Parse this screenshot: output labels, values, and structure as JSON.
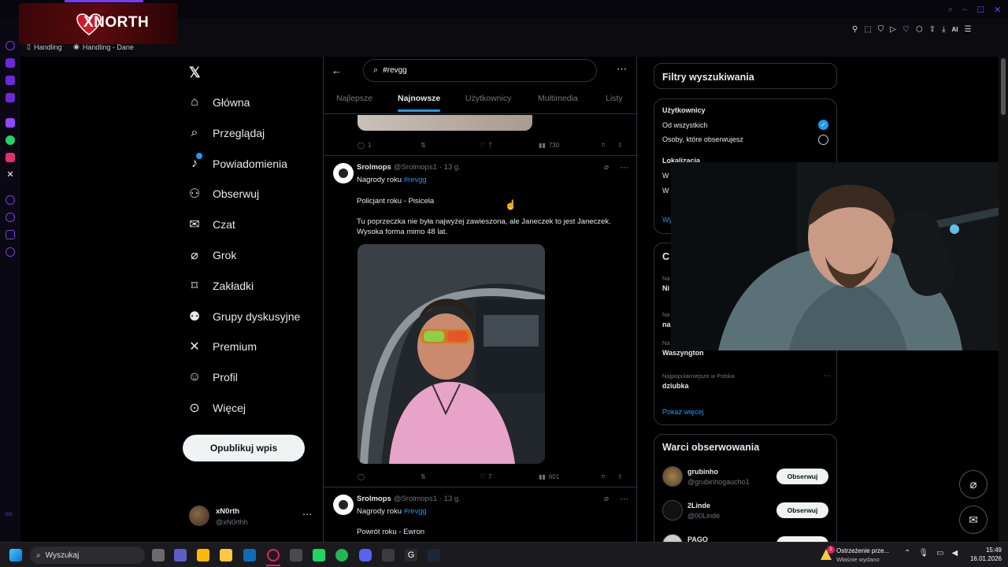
{
  "browser": {
    "bookmarks": [
      "Handling",
      "Handling - Dane"
    ],
    "ai_label": "AI"
  },
  "stream_logo": {
    "text": "XNORTH"
  },
  "nav": {
    "items": [
      {
        "label": "Główna",
        "icon": "home-icon"
      },
      {
        "label": "Przeglądaj",
        "icon": "search-icon"
      },
      {
        "label": "Powiadomienia",
        "icon": "bell-icon"
      },
      {
        "label": "Obserwuj",
        "icon": "add-user-icon"
      },
      {
        "label": "Czat",
        "icon": "mail-icon"
      },
      {
        "label": "Grok",
        "icon": "grok-icon"
      },
      {
        "label": "Zakładki",
        "icon": "bookmark-icon"
      },
      {
        "label": "Grupy dyskusyjne",
        "icon": "groups-icon"
      },
      {
        "label": "Premium",
        "icon": "x-icon"
      },
      {
        "label": "Profil",
        "icon": "profile-icon"
      },
      {
        "label": "Więcej",
        "icon": "more-circle-icon"
      }
    ],
    "post_button": "Opublikuj wpis",
    "account": {
      "name": "xN0rth",
      "handle": "@xN0rthh"
    }
  },
  "search": {
    "query": "#revgg"
  },
  "tabs": [
    "Najlepsze",
    "Najnowsze",
    "Użytkownicy",
    "Multimedia",
    "Listy"
  ],
  "active_tab": "Najnowsze",
  "posts": [
    {
      "stats": {
        "replies": "1",
        "reposts": "",
        "likes": "7",
        "views": "730"
      }
    },
    {
      "author": "Srolmops",
      "handle": "@Srolmops1",
      "time": "· 13 g.",
      "line1_prefix": "Nagrody roku ",
      "hashtag": "#revgg",
      "para1": "Policjant roku - Pisicela",
      "para2": "Tu poprzeczka nie była najwyżej zawieszona, ale Janeczek to jest Janeczek. Wysoka forma mimo 48 lat.",
      "stats": {
        "replies": "",
        "reposts": "",
        "likes": "7",
        "views": "601"
      }
    },
    {
      "author": "Srolmops",
      "handle": "@Srolmops1",
      "time": "· 13 g.",
      "line1_prefix": "Nagrody roku ",
      "hashtag": "#revgg",
      "para1": "Powrót roku - Ewron"
    }
  ],
  "filters": {
    "title": "Filtry wyszukiwania",
    "users_label": "Użytkownicy",
    "option_all": "Od wszystkich",
    "option_following": "Osoby, które obserwujesz",
    "location_label": "Lokalizacja",
    "location_w1": "W",
    "location_w2": "W",
    "more_link": "Wy"
  },
  "trends": {
    "title_partial": "C",
    "items": [
      {
        "context": "Na",
        "name": "Ni"
      },
      {
        "context": "Na",
        "name": "na"
      },
      {
        "context": "Na",
        "name": "Waszyngton"
      },
      {
        "context": "Najpopularniejsze w Polska",
        "name": "dziubka"
      }
    ],
    "show_more": "Pokaż więcej"
  },
  "who_to_follow": {
    "title": "Warci obserwowania",
    "users": [
      {
        "name": "grubinho",
        "handle": "@grubinhogaucho1",
        "button": "Obserwuj"
      },
      {
        "name": "2Linde",
        "handle": "@00Linde",
        "button": "Obserwuj"
      },
      {
        "name": "PAGO",
        "handle": "",
        "button": ""
      }
    ]
  },
  "taskbar": {
    "search_placeholder": "Wyszukaj",
    "notification_title": "Ostrzeżenie prze...",
    "notification_sub": "Właśnie wydano",
    "notification_count": "1",
    "time": "15:49",
    "date": "16.01.2026",
    "side_label": "GX"
  },
  "colors": {
    "accent": "#1d9bf0",
    "opera": "#8b5cf6",
    "logo_red": "#d11a2a"
  }
}
